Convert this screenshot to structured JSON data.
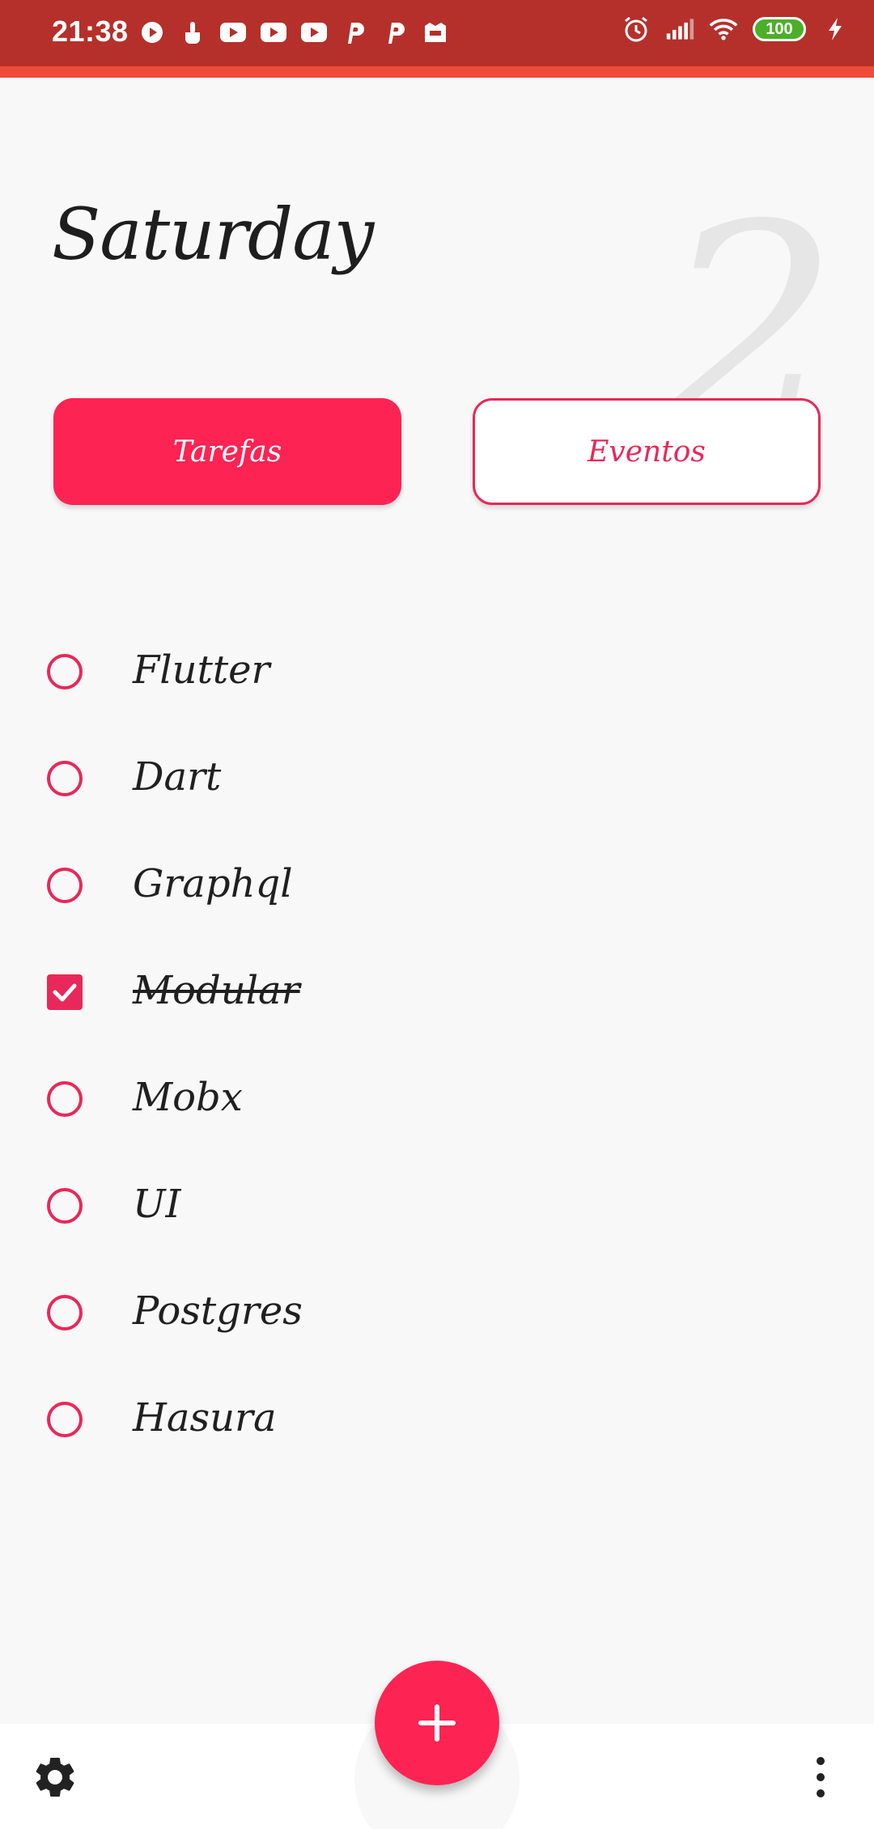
{
  "status_bar": {
    "time": "21:38",
    "battery": "100",
    "left_icons": [
      "media-play-icon",
      "touch-icon",
      "youtube-icon",
      "youtube-icon",
      "youtube-icon",
      "p-icon",
      "p-icon",
      "app-icon"
    ],
    "right_icons": [
      "alarm-icon",
      "signal-icon",
      "wifi-icon",
      "battery-icon",
      "charging-icon"
    ]
  },
  "header": {
    "day": "Saturday",
    "day_number": "2"
  },
  "tabs": [
    {
      "label": "Tarefas",
      "active": true
    },
    {
      "label": "Eventos",
      "active": false
    }
  ],
  "tasks": [
    {
      "label": "Flutter",
      "done": false
    },
    {
      "label": "Dart",
      "done": false
    },
    {
      "label": "Graphql",
      "done": false
    },
    {
      "label": "Modular",
      "done": true
    },
    {
      "label": "Mobx",
      "done": false
    },
    {
      "label": "UI",
      "done": false
    },
    {
      "label": "Postgres",
      "done": false
    },
    {
      "label": "Hasura",
      "done": false
    }
  ],
  "bottom_bar": {
    "fab_icon": "plus-icon",
    "left_icon": "gear-icon",
    "right_icon": "more-vertical-icon"
  },
  "colors": {
    "accent": "#fd2353",
    "status_bar": "#b5302a",
    "status_accent": "#f04a3a",
    "text": "#202020",
    "background": "#f8f8f8"
  }
}
